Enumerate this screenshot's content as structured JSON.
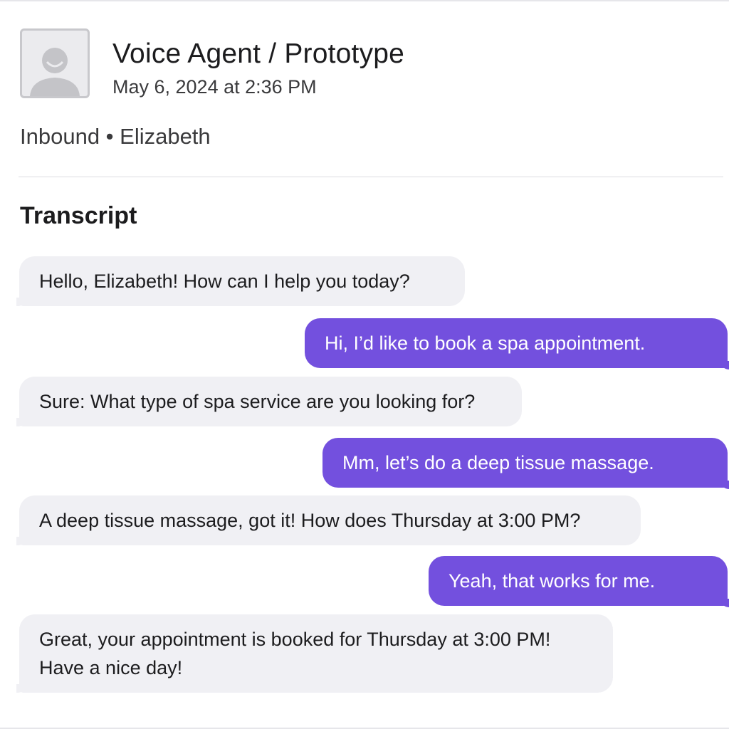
{
  "header": {
    "avatar_icon": "person-placeholder-icon",
    "title": "Voice Agent / Prototype",
    "timestamp": "May 6, 2024 at 2:36 PM"
  },
  "call": {
    "meta": "Inbound • Elizabeth"
  },
  "transcript": {
    "heading": "Transcript",
    "messages": [
      {
        "speaker": "agent",
        "text": "Hello, Elizabeth! How can I help you today?"
      },
      {
        "speaker": "user",
        "text": "Hi, I’d like to book a spa appointment."
      },
      {
        "speaker": "agent",
        "text": "Sure: What type of spa service are you looking for?"
      },
      {
        "speaker": "user",
        "text": "Mm, let’s do a deep tissue massage."
      },
      {
        "speaker": "agent",
        "text": "A deep tissue massage, got it! How does Thursday at 3:00 PM?"
      },
      {
        "speaker": "user",
        "text": "Yeah, that works for me."
      },
      {
        "speaker": "agent",
        "text": "Great, your appointment is booked for Thursday at 3:00 PM!\nHave a nice day!"
      }
    ]
  },
  "colors": {
    "user_bubble": "#7350de",
    "agent_bubble": "#f0f0f4"
  }
}
